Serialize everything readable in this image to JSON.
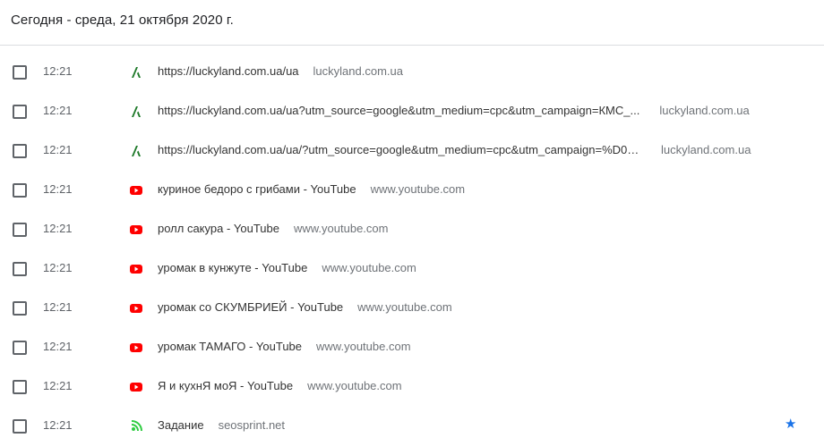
{
  "header": {
    "title": "Сегодня - среда, 21 октября 2020 г."
  },
  "colors": {
    "accent": "#1a73e8",
    "youtube_red": "#ff0000",
    "luckyland_green": "#1f7a2a",
    "seosprint_green": "#2ecc40"
  },
  "entries": [
    {
      "time": "12:21",
      "icon": "luckyland-icon",
      "title": "https://luckyland.com.ua/ua",
      "domain": "luckyland.com.ua"
    },
    {
      "time": "12:21",
      "icon": "luckyland-icon",
      "title": "https://luckyland.com.ua/ua?utm_source=google&utm_medium=cpc&utm_campaign=КМС_...",
      "domain": "luckyland.com.ua"
    },
    {
      "time": "12:21",
      "icon": "luckyland-icon",
      "title": "https://luckyland.com.ua/ua/?utm_source=google&utm_medium=cpc&utm_campaign=%D0%...",
      "domain": "luckyland.com.ua"
    },
    {
      "time": "12:21",
      "icon": "youtube-icon",
      "title": "куриное бедоро с грибами - YouTube",
      "domain": "www.youtube.com"
    },
    {
      "time": "12:21",
      "icon": "youtube-icon",
      "title": "ролл сакура - YouTube",
      "domain": "www.youtube.com"
    },
    {
      "time": "12:21",
      "icon": "youtube-icon",
      "title": "уромак в кунжуте - YouTube",
      "domain": "www.youtube.com"
    },
    {
      "time": "12:21",
      "icon": "youtube-icon",
      "title": "уромак со СКУМБРИЕЙ - YouTube",
      "domain": "www.youtube.com"
    },
    {
      "time": "12:21",
      "icon": "youtube-icon",
      "title": "уромак ТАМАГО - YouTube",
      "domain": "www.youtube.com"
    },
    {
      "time": "12:21",
      "icon": "youtube-icon",
      "title": "Я и кухнЯ моЯ - YouTube",
      "domain": "www.youtube.com"
    },
    {
      "time": "12:21",
      "icon": "seosprint-icon",
      "title": "Задание",
      "domain": "seosprint.net",
      "starred": true
    }
  ]
}
